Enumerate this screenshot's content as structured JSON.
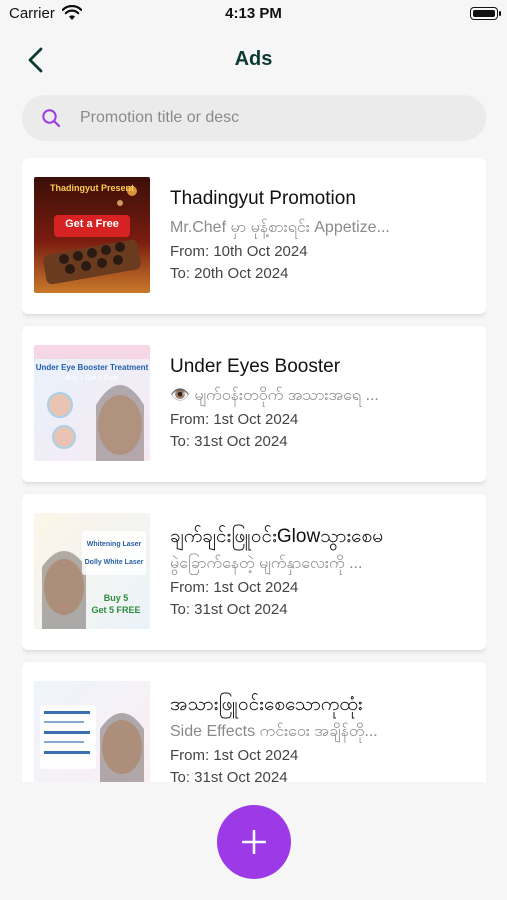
{
  "status": {
    "carrier": "Carrier",
    "time": "4:13 PM"
  },
  "header": {
    "title": "Ads"
  },
  "search": {
    "placeholder": "Promotion title or desc",
    "value": ""
  },
  "ads": [
    {
      "title": "Thadingyut Promotion",
      "description": "Mr.Chef မှာ မုန့်စားရင်း Appetize...",
      "from": "From: 10th Oct 2024",
      "to": "To: 20th Oct 2024",
      "image_text": [
        "Thadingyut Present",
        "Get a Free"
      ]
    },
    {
      "title": "Under Eyes Booster",
      "description": "👁️ မျက်ဝန်းတဝိုက် အသားအရေ ...",
      "from": "From: 1st Oct 2024",
      "to": "To: 31st Oct 2024",
      "image_text": [
        "Under Eye Booster Treatment",
        "Buy 1 Get 1 Free"
      ]
    },
    {
      "title": "ချက်ချင်းဖြူဝင်းGlowသွားစေမ",
      "description": "မွဲခြောက်နေတဲ့ မျက်နှာလေးကို ...",
      "from": "From: 1st Oct 2024",
      "to": "To: 31st Oct 2024",
      "image_text": [
        "Whitening Laser",
        "Dolly White Laser",
        "Buy 5",
        "Get 5 FREE"
      ]
    },
    {
      "title": "အသားဖြူဝင်းစေသောကုထုံး",
      "description": "Side Effects ကင်းဝေး အချိန်တို...",
      "from": "From: 1st Oct 2024",
      "to": "To: 31st Oct 2024",
      "image_text": []
    }
  ],
  "colors": {
    "accent": "#9b3ae6",
    "title": "#0c3b34"
  }
}
